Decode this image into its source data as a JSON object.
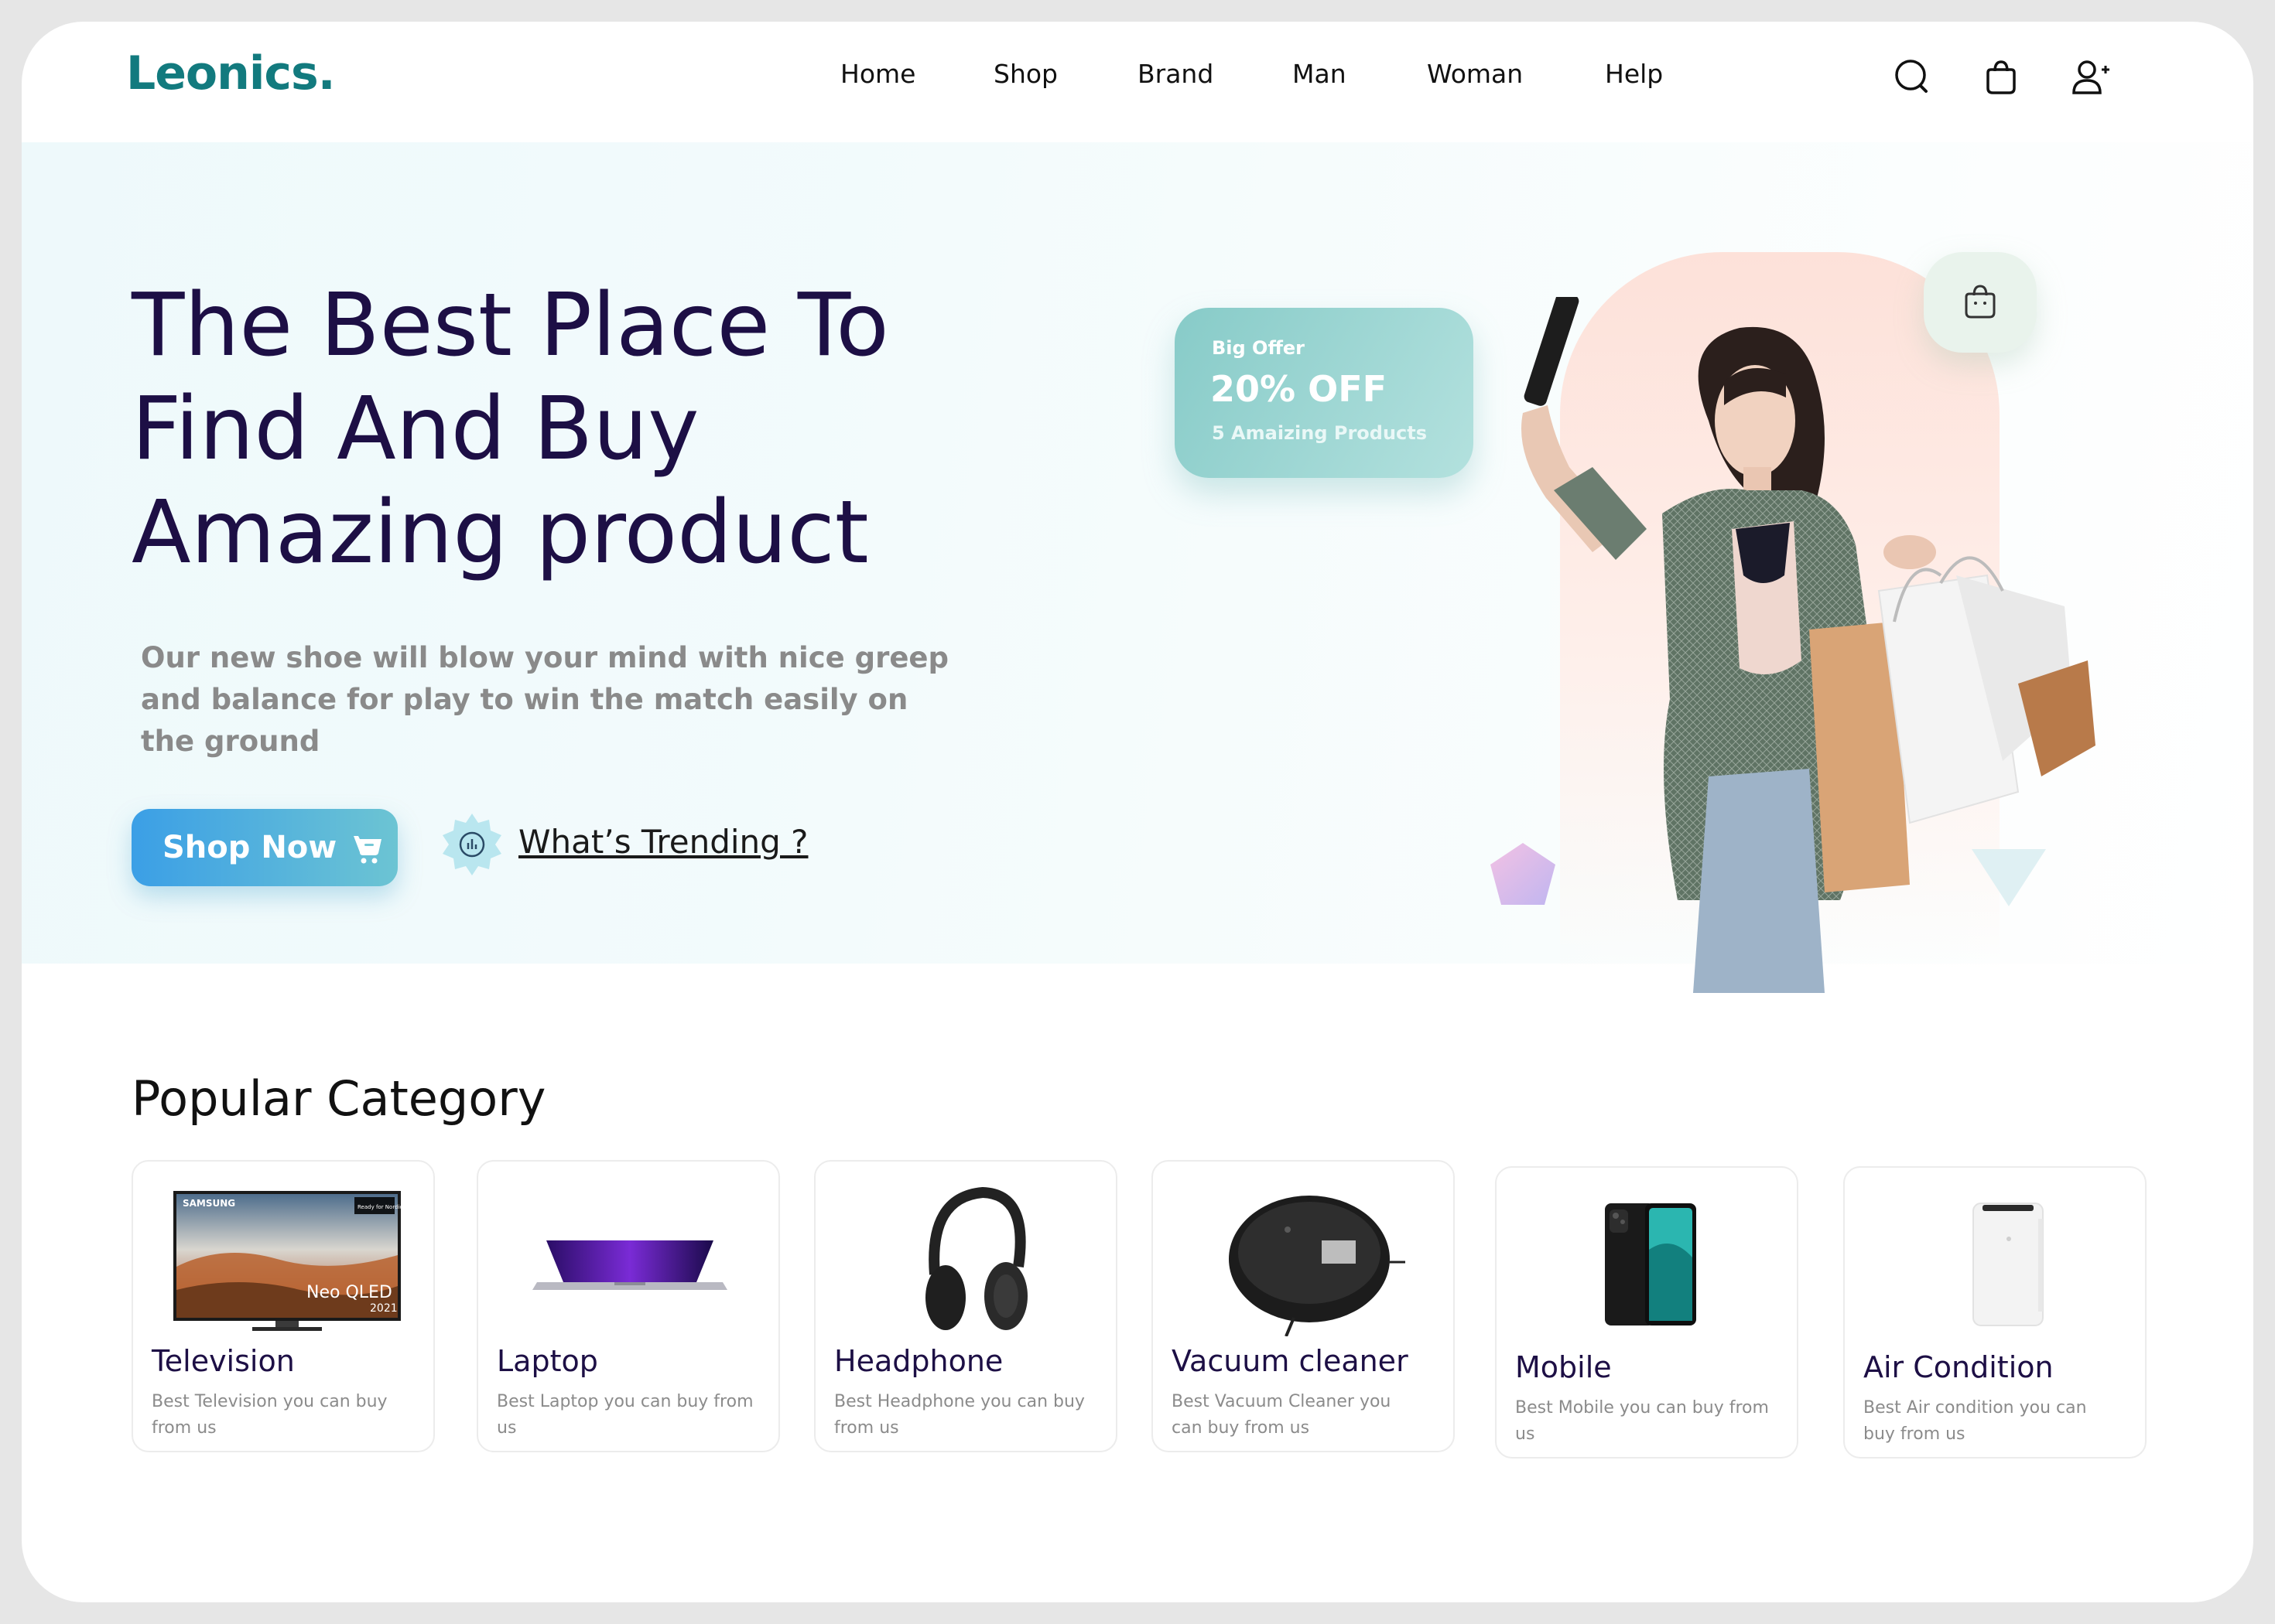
{
  "brand": {
    "logo": "Leonics."
  },
  "nav": [
    {
      "label": "Home"
    },
    {
      "label": "Shop"
    },
    {
      "label": "Brand"
    },
    {
      "label": "Man"
    },
    {
      "label": "Woman"
    },
    {
      "label": "Help"
    }
  ],
  "header_icons": [
    "search-icon",
    "shopping-bag-icon",
    "add-user-icon"
  ],
  "hero": {
    "title_lines": [
      "The Best Place To",
      "Find And Buy",
      "Amazing product"
    ],
    "description_lines": [
      "Our new shoe will blow your mind with nice greep",
      "and balance for play to win the match easily on",
      "the ground"
    ],
    "shop_button": "Shop Now",
    "trending_link": "What’s Trending ?",
    "offer": {
      "small": "Big Offer",
      "big": "20% OFF",
      "sub": "5 Amaizing Products"
    }
  },
  "category": {
    "title": "Popular Category",
    "items": [
      {
        "name": "Television",
        "desc_lines": [
          "Best Television you can buy",
          "from us"
        ],
        "tv_brand": "SAMSUNG",
        "tv_badge": "Ready for Nordics",
        "tv_model": "Neo QLED",
        "tv_year": "2021"
      },
      {
        "name": "Laptop",
        "desc_lines": [
          "Best Laptop you can buy from",
          "us"
        ]
      },
      {
        "name": "Headphone",
        "desc_lines": [
          "Best Headphone you can buy",
          "from us"
        ]
      },
      {
        "name": "Vacuum cleaner",
        "desc_lines": [
          "Best Vacuum Cleaner you",
          "can buy from us"
        ]
      },
      {
        "name": "Mobile",
        "desc_lines": [
          "Best Mobile you can buy from",
          "us"
        ]
      },
      {
        "name": "Air Condition",
        "desc_lines": [
          "Best Air condition you can",
          "buy from us"
        ]
      }
    ]
  },
  "colors": {
    "brand": "#127a7e",
    "heading": "#1d0f45",
    "button_start": "#3b9fe6",
    "button_end": "#6cc4d3",
    "offer_card": "#87cbc8",
    "arch": "#fde1d9"
  }
}
